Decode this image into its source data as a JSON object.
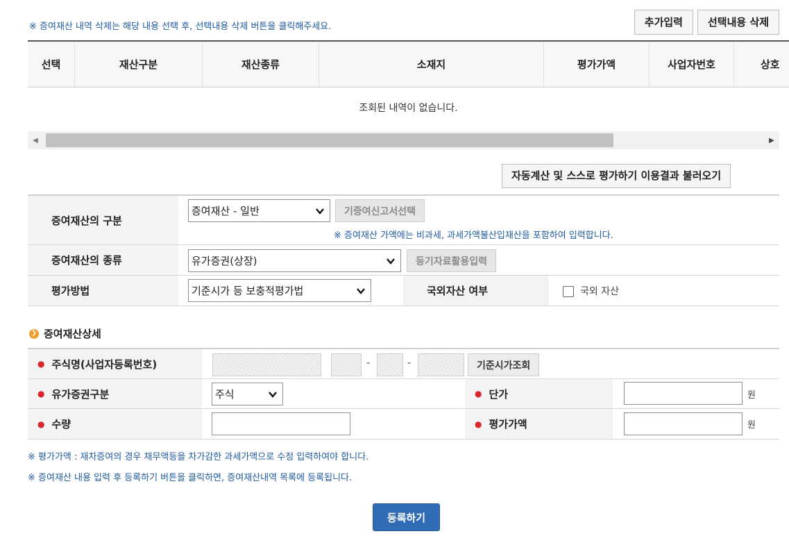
{
  "notice_top": "※ 증여재산 내역 삭제는 해당 내용 선택 후, 선택내용 삭제 버튼을  클릭해주세요.",
  "toolbar": {
    "add_label": "추가입력",
    "delete_label": "선택내용 삭제"
  },
  "grid": {
    "columns": [
      "선택",
      "재산구분",
      "재산종류",
      "소재지",
      "평가가액",
      "사업자번호",
      "상호"
    ],
    "empty_message": "조회된 내역이 없습니다."
  },
  "auto_calc_label": "자동계산 및 스스로 평가하기 이용결과 불러오기",
  "form": {
    "gubun_label": "증여재산의 구분",
    "gubun_value": "증여재산 - 일반",
    "prior_report_label": "기증여신고서선택",
    "gubun_note": "※ 증여재산 가액에는 비과세, 과세가액불산입재산을 포함하여 입력합니다.",
    "kind_label": "증여재산의 종류",
    "kind_value": "유가증권(상장)",
    "registry_label": "등기자료활용입력",
    "method_label": "평가방법",
    "method_value": "기준시가 등 보충적평가법",
    "overseas_label": "국외자산 여부",
    "overseas_checkbox_label": "국외 자산"
  },
  "detail": {
    "title": "증여재산상세",
    "stock_name_label": "주식명(사업자등록번호)",
    "std_price_label": "기준시가조회",
    "security_type_label": "유가증권구분",
    "security_type_value": "주식",
    "unit_price_label": "단가",
    "quantity_label": "수량",
    "eval_amount_label": "평가가액",
    "won": "원",
    "dash": "-"
  },
  "footnotes": {
    "note1": "※ 평가가액 : 재차증여의 경우 채무액등을 차가감한 과세가액으로 수정 입력하여야 합니다.",
    "note2": "※ 증여재산 내용 입력 후 등록하기 버튼을 클릭하면, 증여재산내역 목록에 등록됩니다."
  },
  "register_label": "등록하기"
}
